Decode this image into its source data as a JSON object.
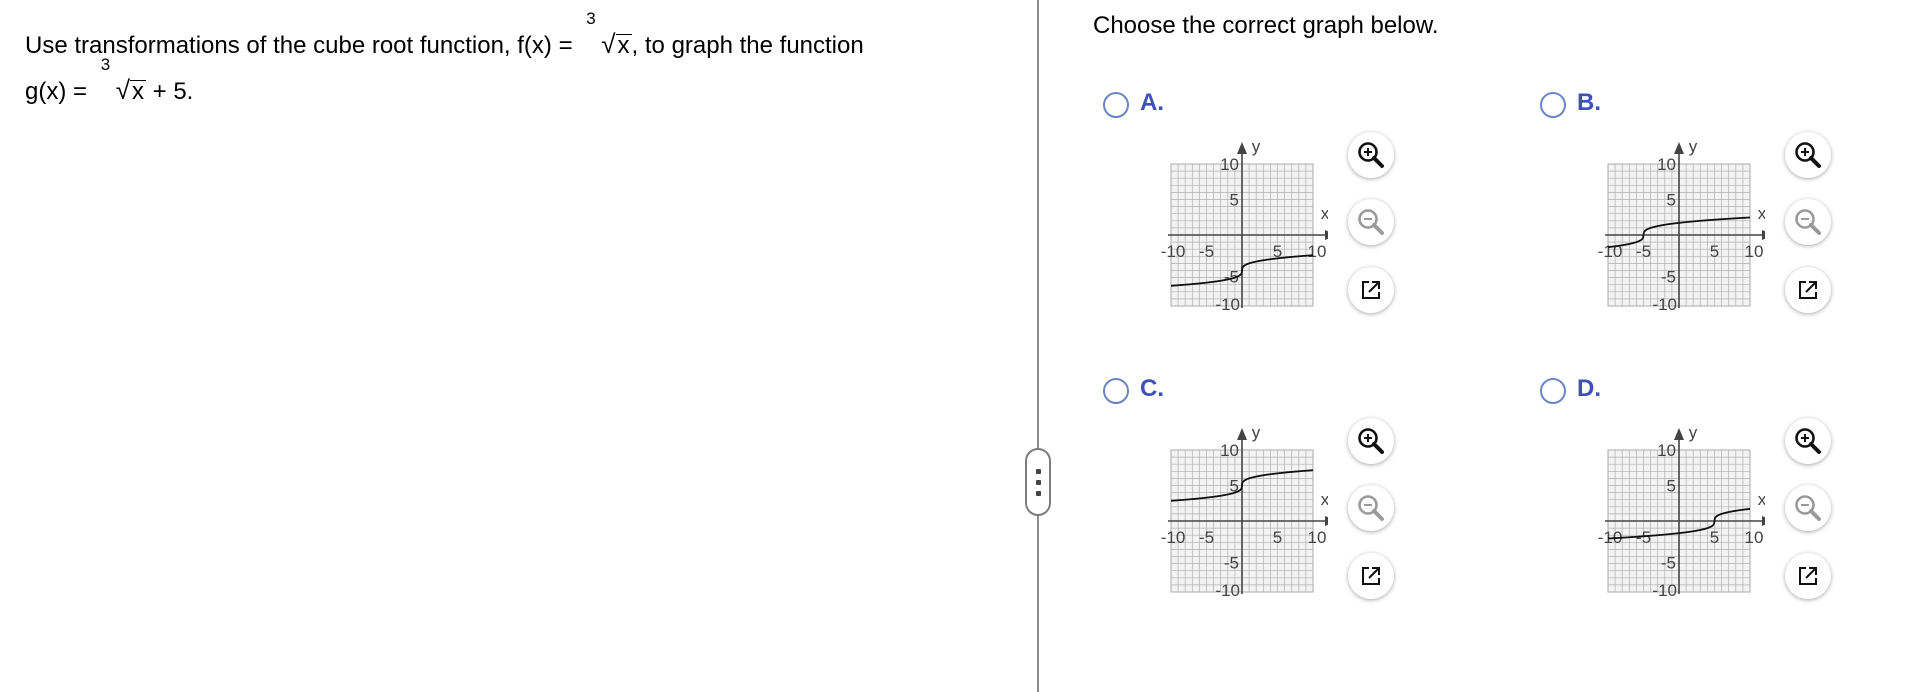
{
  "question": {
    "line1_pre": "Use transformations of the cube root function, f(x) =",
    "line1_index": "3",
    "line1_radicand": "x",
    "line1_post": ", to graph the function",
    "line2_pre": "g(x) =",
    "line2_index": "3",
    "line2_radicand": "x",
    "line2_post": "+ 5."
  },
  "answer": {
    "prompt": "Choose the correct graph below."
  },
  "graph_labels": {
    "x_axis": "x",
    "y_axis": "y",
    "tick_neg10": "-10",
    "tick_neg5": "-5",
    "tick_5": "5",
    "tick_10": "10"
  },
  "options": [
    {
      "letter": "A.",
      "curve": {
        "type": "cube-root",
        "h": 0,
        "k": -5
      }
    },
    {
      "letter": "B.",
      "curve": {
        "type": "cube-root",
        "h": -5,
        "k": 0
      }
    },
    {
      "letter": "C.",
      "curve": {
        "type": "cube-root",
        "h": 0,
        "k": 5
      }
    },
    {
      "letter": "D.",
      "curve": {
        "type": "cube-root",
        "h": 5,
        "k": 0
      }
    }
  ],
  "graph_window": {
    "xmin": -10,
    "xmax": 10,
    "ymin": -10,
    "ymax": 10
  },
  "icons": {
    "zoom_in": "zoom-in-icon",
    "zoom_out": "zoom-out-icon",
    "popout": "popout-icon"
  },
  "colors": {
    "option_letter": "#3f51b5",
    "radio_border": "#6c84c4",
    "grid": "#b0b0b0",
    "divider": "#8a8a8a"
  }
}
